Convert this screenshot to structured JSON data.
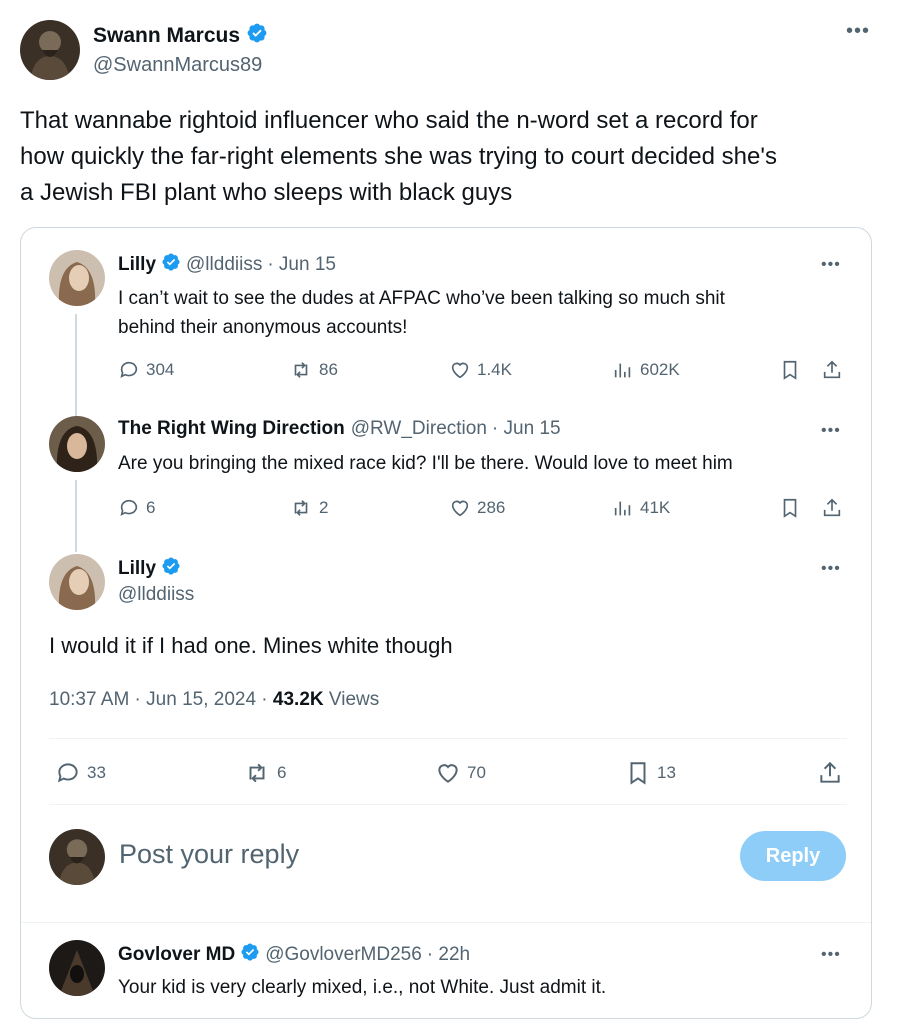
{
  "main_post": {
    "author_name": "Swann Marcus",
    "author_handle": "@SwannMarcus89",
    "text_line1": "That wannabe rightoid influencer who said the n-word set a record for",
    "text_line2": "how quickly the far-right elements she was trying to court decided she's",
    "text_line3": "a Jewish FBI plant who sleeps with black guys"
  },
  "quoted": {
    "reply1": {
      "author_name": "Lilly",
      "author_handle": "@llddiiss",
      "date": "· Jun 15",
      "text_line1": "I can’t wait to see the dudes at AFPAC who’ve been talking so much shit",
      "text_line2": "behind their anonymous accounts!",
      "replies": "304",
      "reposts": "86",
      "likes": "1.4K",
      "views": "602K"
    },
    "reply2": {
      "author_name": "The Right Wing Direction",
      "author_handle": "@RW_Direction",
      "date": "· Jun 15",
      "text": "Are you bringing the mixed race kid? I'll be there. Would love to meet him",
      "replies": "6",
      "reposts": "2",
      "likes": "286",
      "views": "41K"
    },
    "focus": {
      "author_name": "Lilly",
      "author_handle": "@llddiiss",
      "text": "I would it if I had one. Mines white though",
      "timestamp": "10:37 AM · Jun 15, 2024 · ",
      "views_count": "43.2K",
      "views_label": " Views",
      "replies": "33",
      "reposts": "6",
      "likes": "70",
      "bookmarks": "13"
    },
    "composer": {
      "placeholder": "Post your reply",
      "reply_button": "Reply"
    },
    "reply3": {
      "author_name": "Govlover MD",
      "author_handle": "@GovloverMD256",
      "date": "· 22h",
      "text": "Your kid is very clearly mixed, i.e., not White. Just admit it."
    }
  },
  "colors": {
    "verified": "#1d9bf0",
    "muted": "#536471",
    "reply_button_disabled": "#8ecdf7"
  }
}
